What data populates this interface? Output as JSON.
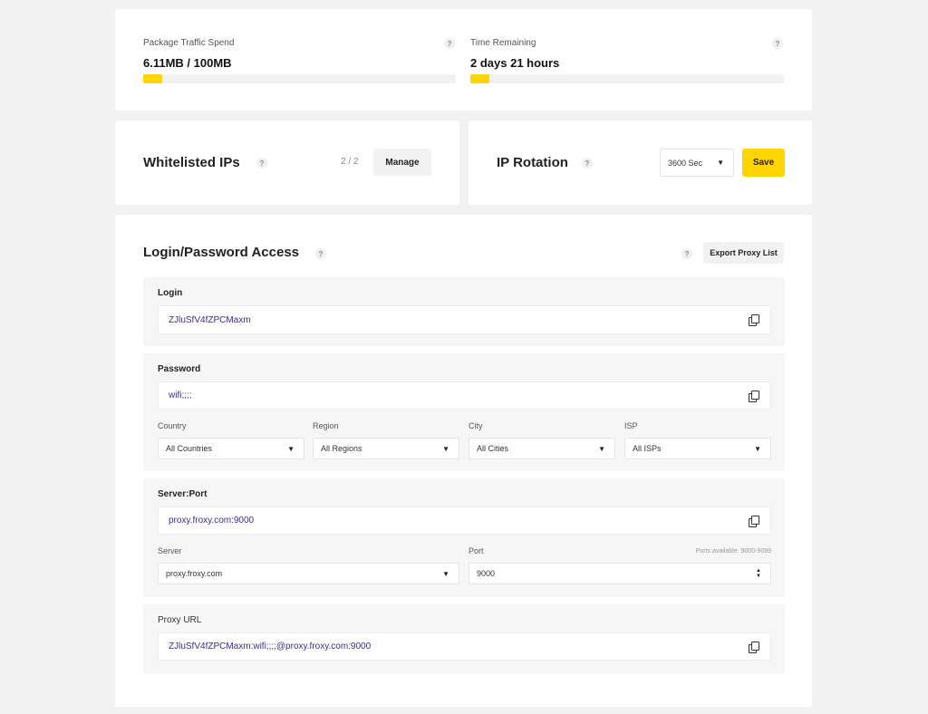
{
  "traffic": {
    "label": "Package Traffic Spend",
    "value": "6.11MB / 100MB",
    "progress_fraction": 0.0611,
    "help": "?"
  },
  "time": {
    "label": "Time Remaining",
    "value": "2 days 21 hours",
    "progress_fraction": 0.06,
    "help": "?"
  },
  "whitelist": {
    "title": "Whitelisted IPs",
    "help": "?",
    "count": "2 / 2",
    "manage_label": "Manage"
  },
  "rotation": {
    "title": "IP Rotation",
    "help": "?",
    "selected": "3600 Sec",
    "caret": "▼",
    "save_label": "Save"
  },
  "access": {
    "title": "Login/Password Access",
    "help": "?",
    "export_help": "?",
    "export_label": "Export Proxy List"
  },
  "login": {
    "label": "Login",
    "value": "ZJluSfV4fZPCMaxm",
    "copy_icon": "copy-icon"
  },
  "password": {
    "label": "Password",
    "value": "wifi;;;;"
  },
  "filters": {
    "country_label": "Country",
    "country_value": "All Countries",
    "region_label": "Region",
    "region_value": "All Regions",
    "city_label": "City",
    "city_value": "All Cities",
    "isp_label": "ISP",
    "isp_value": "All ISPs",
    "caret": "▼"
  },
  "server_port": {
    "label": "Server:Port",
    "value": "proxy.froxy.com:9000",
    "server_label": "Server",
    "server_value": "proxy.froxy.com",
    "port_label": "Port",
    "port_value": "9000",
    "ports_note": "Ports available: 9000-9099",
    "stepper": "▲▼"
  },
  "proxy_url": {
    "label": "Proxy URL",
    "value": "ZJluSfV4fZPCMaxm:wifi;;;;@proxy.froxy.com:9000"
  },
  "colors": {
    "accent": "#ffd400",
    "link_text": "#3a2d8a",
    "background": "#f2f2f2"
  }
}
